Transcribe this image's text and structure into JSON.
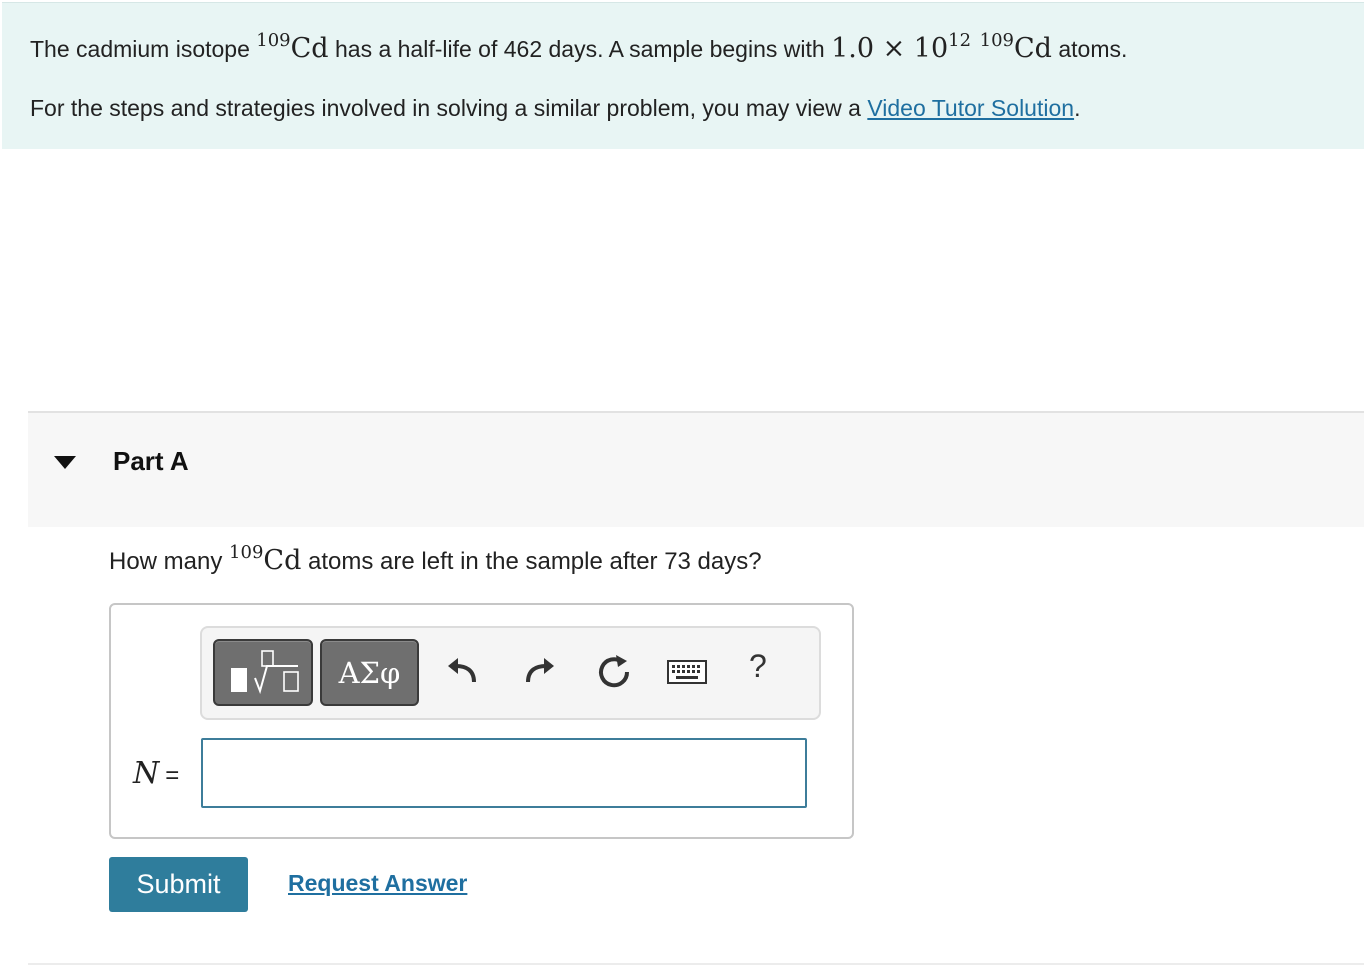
{
  "problem": {
    "text_1": "The cadmium isotope ",
    "isotope_mass": "109",
    "element": "Cd",
    "text_2": " has a half-life of 462 days. A sample begins with ",
    "initial_count": "1.0 × 10",
    "initial_exponent": "12",
    "isotope_mass_2": "109",
    "element_2": "Cd",
    "text_3": " atoms.",
    "hint_prefix": "For the steps and strategies involved in solving a similar problem, you may view a ",
    "hint_link": "Video Tutor Solution",
    "hint_suffix": "."
  },
  "part": {
    "title": "Part A",
    "question_prefix": "How many ",
    "question_isotope": "109",
    "question_element": "Cd",
    "question_suffix": " atoms are left in the sample after 73 days?"
  },
  "toolbar": {
    "symbols_label": "ΑΣφ",
    "help_label": "?",
    "icons": [
      "templates-icon",
      "undo-icon",
      "redo-icon",
      "reset-icon",
      "keyboard-icon"
    ]
  },
  "answer": {
    "variable": "N",
    "equals": "=",
    "value": ""
  },
  "actions": {
    "submit_label": "Submit",
    "request_label": "Request Answer"
  }
}
